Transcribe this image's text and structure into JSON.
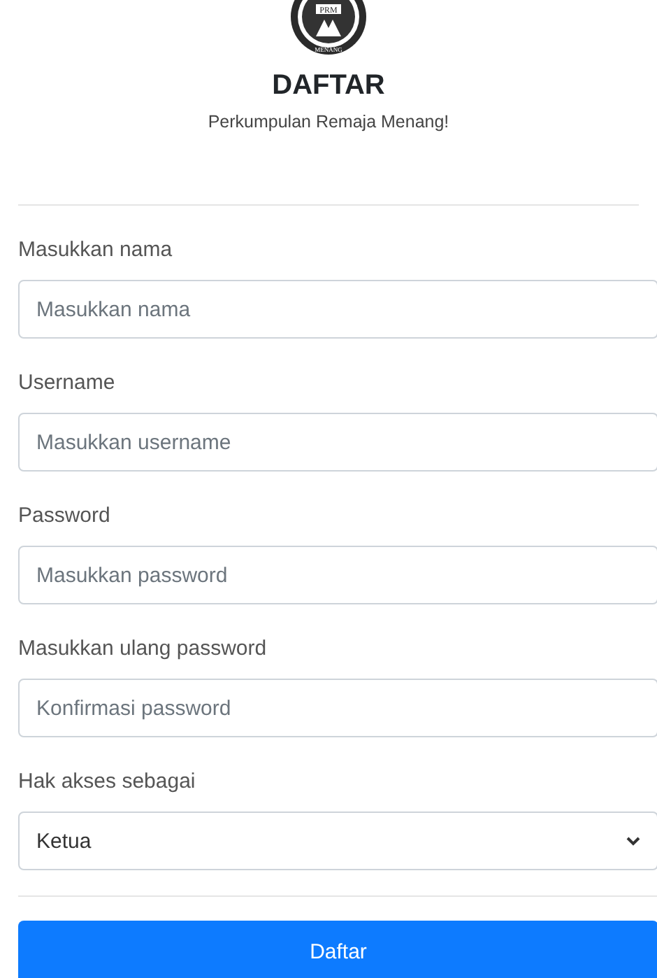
{
  "logo": {
    "initials": "PRM",
    "motto": "MENANG"
  },
  "title": "DAFTAR",
  "subtitle": "Perkumpulan Remaja Menang!",
  "fields": [
    {
      "kind": "text",
      "label": "Masukkan nama",
      "placeholder": "Masukkan nama"
    },
    {
      "kind": "text",
      "label": "Username",
      "placeholder": "Masukkan username"
    },
    {
      "kind": "password",
      "label": "Password",
      "placeholder": "Masukkan password"
    },
    {
      "kind": "password",
      "label": "Masukkan ulang password",
      "placeholder": "Konfirmasi password"
    },
    {
      "kind": "select",
      "label": "Hak akses sebagai",
      "value": "Ketua"
    }
  ],
  "submit": "Daftar"
}
